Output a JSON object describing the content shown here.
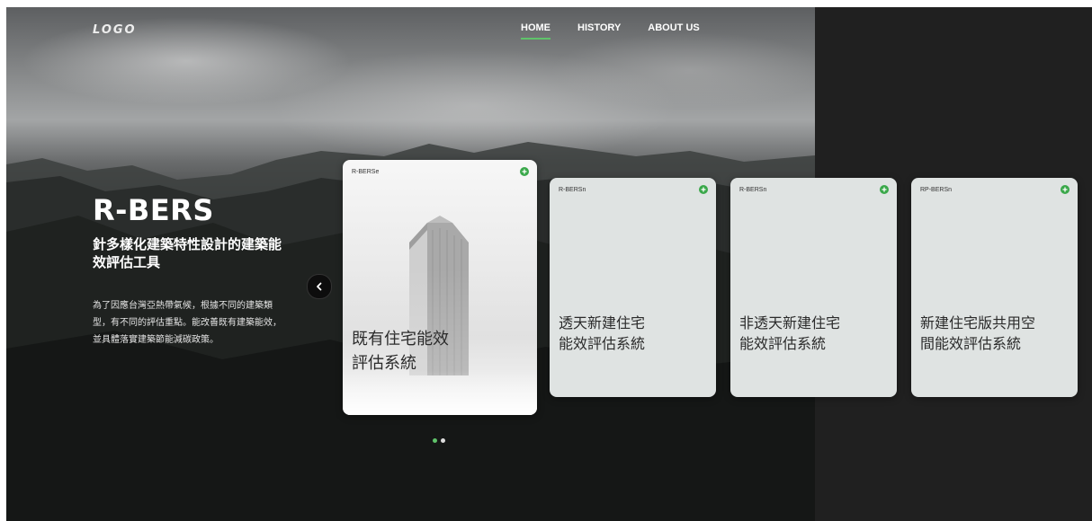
{
  "nav": {
    "logo": "LOGO",
    "items": [
      {
        "label": "HOME",
        "active": true
      },
      {
        "label": "HISTORY",
        "active": false
      },
      {
        "label": "ABOUT US",
        "active": false
      }
    ]
  },
  "hero": {
    "title": "R-BERS",
    "subtitle": "針多樣化建築特性設計的建築能效評估工具",
    "description": "為了因應台灣亞熱帶氣候，根據不同的建築類型，有不同的評估重點。能改善既有建築能效，並具體落實建築節能減碳政策。"
  },
  "cards": [
    {
      "tag": "R-BERSe",
      "title": "既有住宅能效\n評估系統"
    },
    {
      "tag": "R-BERSn",
      "title": "透天新建住宅\n能效評估系統"
    },
    {
      "tag": "R-BERSn",
      "title": "非透天新建住宅\n能效評估系統"
    },
    {
      "tag": "RP-BERSn",
      "title": "新建住宅版共用空\n間能效評估系統"
    }
  ],
  "carousel": {
    "page_count": 2,
    "active_index": 0
  },
  "colors": {
    "accent": "#5fc36a",
    "card_bg": "#dfe3e2",
    "plus_green": "#3aa84a",
    "right_panel": "#202020"
  },
  "icons": {
    "prev": "chevron-left-icon",
    "add": "plus-circle-icon"
  }
}
